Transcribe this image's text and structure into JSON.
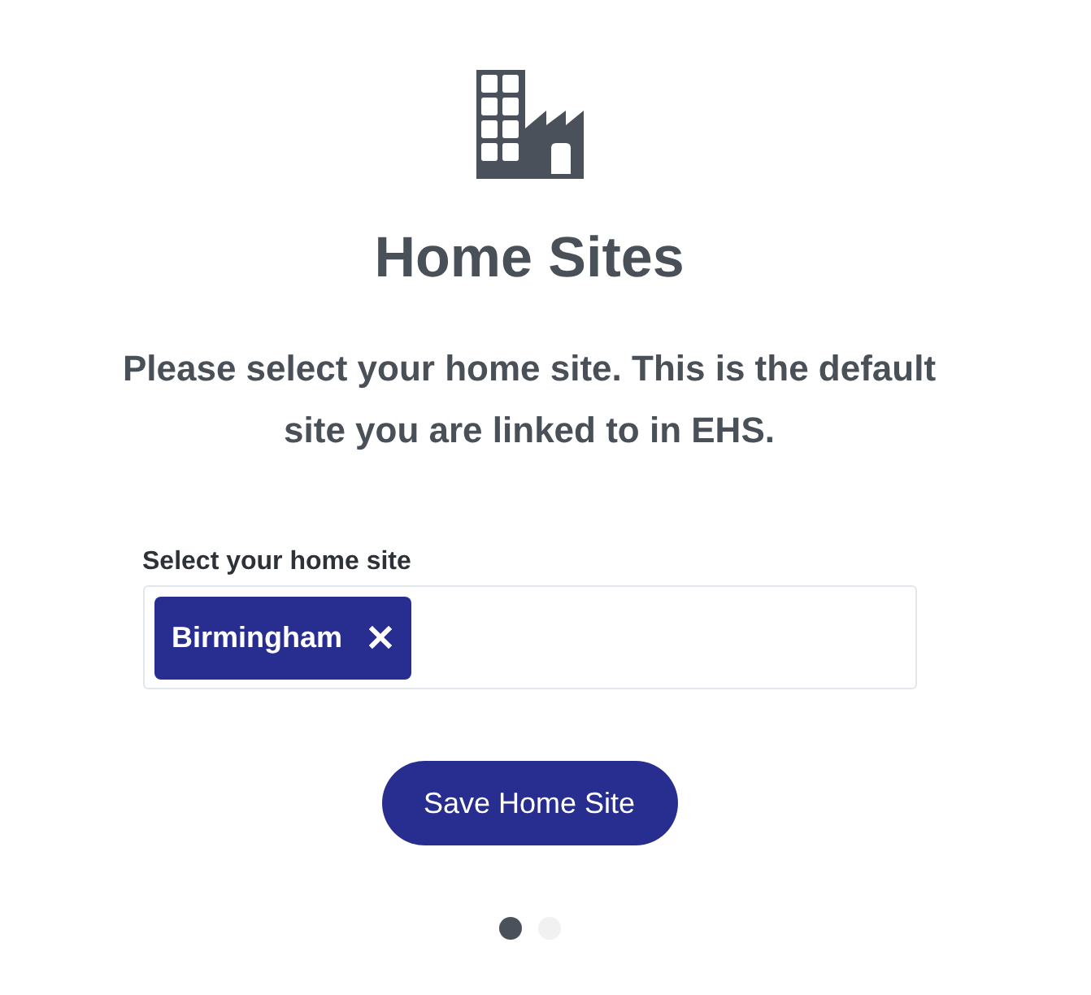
{
  "header": {
    "title": "Home Sites",
    "description": "Please select your home site. This is the default site you are linked to in EHS."
  },
  "site_picker": {
    "label": "Select your home site",
    "selected_sites": [
      {
        "name": "Birmingham"
      }
    ]
  },
  "save_button": {
    "label": "Save Home Site"
  },
  "pager": [
    {
      "selected": true
    },
    {
      "selected": false
    }
  ]
}
